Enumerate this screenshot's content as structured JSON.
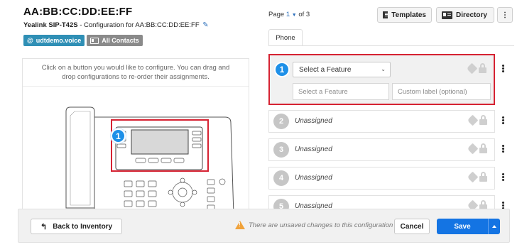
{
  "header": {
    "mac": "AA:BB:CC:DD:EE:FF",
    "model": "Yealink SIP-T42S",
    "config_text": " - Configuration for AA:BB:CC:DD:EE:FF"
  },
  "badges": {
    "domain": "udtdemo.voice",
    "contacts": "All Contacts"
  },
  "left_panel": {
    "instructions": "Click on a button you would like to configure. You can drag and drop configurations to re-order their assignments.",
    "selected_line": "1"
  },
  "pagination": {
    "prefix": "Page ",
    "current": "1",
    "suffix": " of 3"
  },
  "toolbar": {
    "templates_label": "Templates",
    "directory_label": "Directory"
  },
  "tabs": [
    {
      "label": "Phone"
    }
  ],
  "active_slot": {
    "number": "1",
    "select_value": "Select a Feature",
    "feature_placeholder": "Select a Feature",
    "label_placeholder": "Custom label (optional)"
  },
  "slots": [
    {
      "number": "2",
      "label": "Unassigned"
    },
    {
      "number": "3",
      "label": "Unassigned"
    },
    {
      "number": "4",
      "label": "Unassigned"
    },
    {
      "number": "5",
      "label": "Unassigned"
    }
  ],
  "footer": {
    "back_label": "Back to Inventory",
    "unsaved_msg": "There are unsaved changes to this configuration",
    "cancel_label": "Cancel",
    "save_label": "Save"
  },
  "colors": {
    "accent": "#1474e3",
    "highlight": "#d62232",
    "warning": "#f0a23a"
  }
}
